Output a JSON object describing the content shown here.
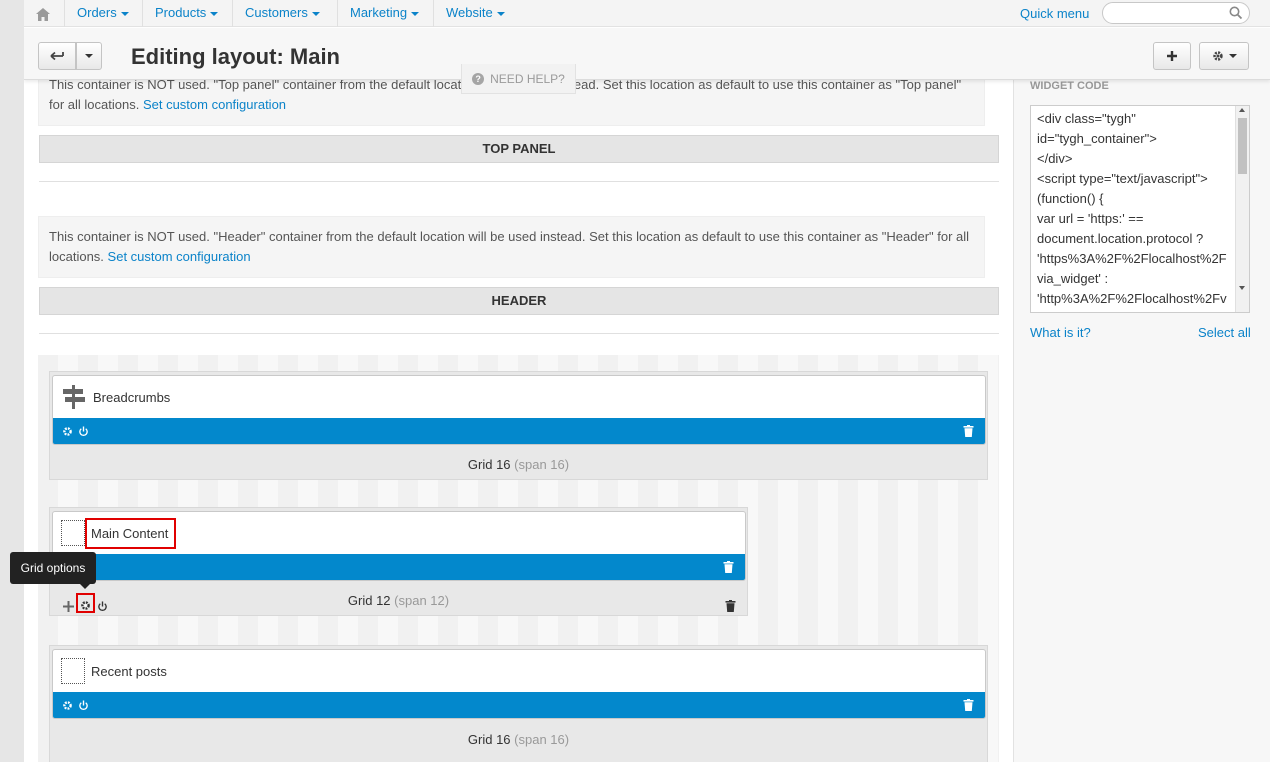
{
  "nav": {
    "home_icon": "home-icon",
    "items": [
      "Orders",
      "Products",
      "Customers",
      "Marketing",
      "Website"
    ],
    "quick_menu": "Quick menu",
    "search_placeholder": ""
  },
  "header": {
    "title": "Editing layout: Main",
    "need_help": "NEED HELP?"
  },
  "containers": {
    "top_panel_notice": "This container is NOT used. \"Top panel\" container from the default location will be used instead. Set this location as default to use this container as \"Top panel\" for all locations.",
    "top_panel_link": "Set custom configuration",
    "top_panel_label": "TOP PANEL",
    "header_notice": "This container is NOT used. \"Header\" container from the default location will be used instead. Set this location as default to use this container as \"Header\" for all locations.",
    "header_link": "Set custom configuration",
    "header_label": "HEADER"
  },
  "grids": [
    {
      "block": "Breadcrumbs",
      "grid": "Grid 16",
      "span": "(span 16)"
    },
    {
      "block": "Main Content",
      "grid": "Grid 12",
      "span": "(span 12)"
    },
    {
      "block": "Recent posts",
      "grid": "Grid 16",
      "span": "(span 16)"
    }
  ],
  "tooltip": "Grid options",
  "sidebar": {
    "title": "WIDGET CODE",
    "code": "<div class=\"tygh\"\nid=\"tygh_container\">\n</div>\n<script type=\"text/javascript\">\n(function() {\nvar url = 'https:' ==\ndocument.location.protocol ?\n'https%3A%2F%2Flocalhost%2F\nvia_widget' :\n'http%3A%2F%2Flocalhost%2Fv",
    "what_is_it": "What is it?",
    "select_all": "Select all"
  },
  "colors": {
    "accent": "#0388cc",
    "link": "#0b83c9",
    "highlight": "#e00000"
  }
}
